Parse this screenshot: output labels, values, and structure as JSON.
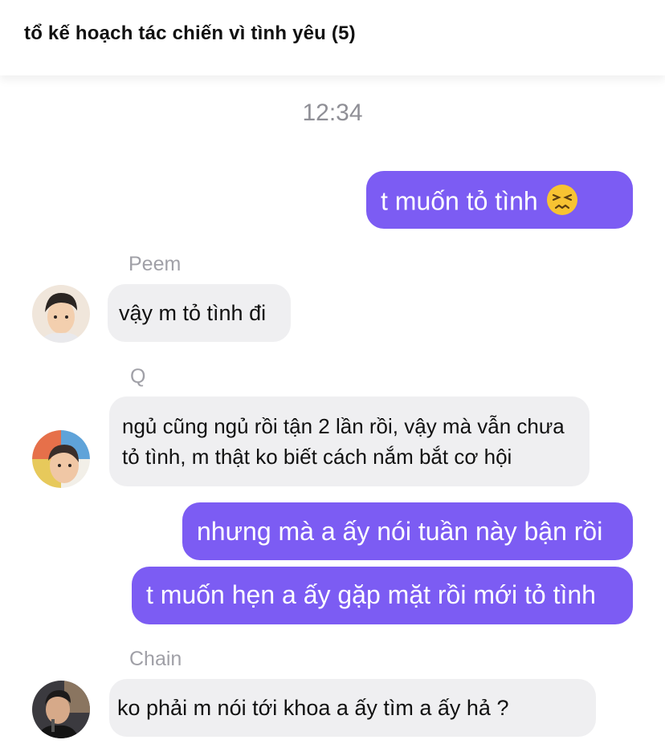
{
  "header": {
    "title": "tổ kế hoạch tác chiến vì tình yêu (5)"
  },
  "chat": {
    "timestamp": "12:34",
    "messages": [
      {
        "from": "me",
        "text": "t muốn tỏ tình"
      },
      {
        "from": "Peem",
        "text": "vậy m tỏ tình đi"
      },
      {
        "from": "Q",
        "lines": [
          "ngủ cũng ngủ rồi tận 2 lần rồi, vậy mà vẫn chưa",
          "tỏ tình, m thật ko biết cách nắm bắt cơ hội"
        ]
      },
      {
        "from": "me",
        "text": "nhưng mà a ấy nói tuần này bận rồi"
      },
      {
        "from": "me",
        "text": "t muốn hẹn a ấy gặp mặt rồi mới tỏ tình"
      },
      {
        "from": "Chain",
        "text": "ko phải m nói tới khoa a ấy tìm a ấy hả ?"
      }
    ],
    "senders": {
      "peem": "Peem",
      "q": "Q",
      "chain": "Chain"
    }
  },
  "icons": {
    "emoji_1": "confounded-face-emoji"
  },
  "colors": {
    "outgoing": "#7c5cf3",
    "incoming": "#efeff1",
    "sender_name": "#a0a0a7"
  }
}
